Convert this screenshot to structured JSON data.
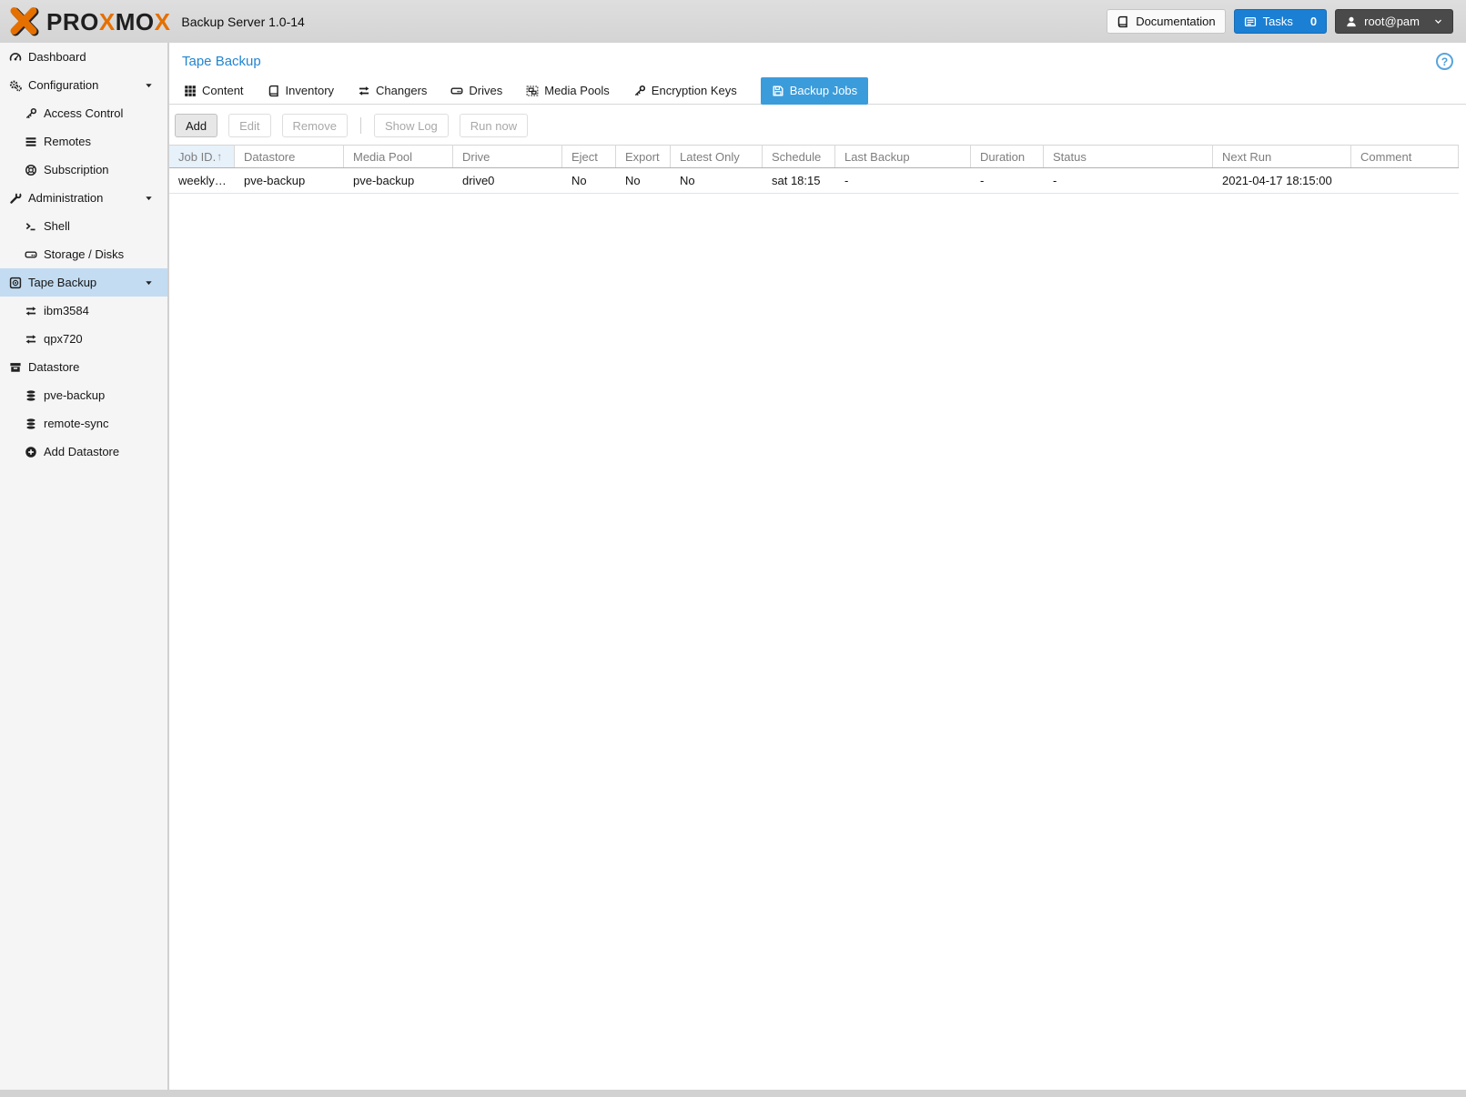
{
  "colors": {
    "accent": "#1b7fd4",
    "tab-active": "#3b9cdb",
    "selected-bg": "#c3dcf1",
    "title-blue": "#2385cf",
    "brand-orange": "#e57000",
    "brand-dark": "#1f1f1f"
  },
  "topbar": {
    "brand_letters": [
      {
        "text": "PRO",
        "color": "#1f1f1f"
      },
      {
        "text": "X",
        "color": "#e57000"
      },
      {
        "text": "MO",
        "color": "#1f1f1f"
      },
      {
        "text": "X",
        "color": "#e57000"
      }
    ],
    "product_title": "Backup Server 1.0-14",
    "documentation_label": "Documentation",
    "tasks_label": "Tasks",
    "tasks_count": "0",
    "user_label": "root@pam"
  },
  "sidebar": {
    "items": [
      {
        "label": "Dashboard",
        "icon": "dashboard-icon",
        "level": 0
      },
      {
        "label": "Configuration",
        "icon": "gears-icon",
        "level": 0,
        "expanded": true
      },
      {
        "label": "Access Control",
        "icon": "key-icon",
        "level": 1
      },
      {
        "label": "Remotes",
        "icon": "list-icon",
        "level": 1
      },
      {
        "label": "Subscription",
        "icon": "life-ring-icon",
        "level": 1
      },
      {
        "label": "Administration",
        "icon": "wrench-icon",
        "level": 0,
        "expanded": true
      },
      {
        "label": "Shell",
        "icon": "terminal-icon",
        "level": 1
      },
      {
        "label": "Storage / Disks",
        "icon": "hdd-icon",
        "level": 1
      },
      {
        "label": "Tape Backup",
        "icon": "tape-icon",
        "level": 0,
        "expanded": true,
        "selected": true
      },
      {
        "label": "ibm3584",
        "icon": "exchange-icon",
        "level": 1
      },
      {
        "label": "qpx720",
        "icon": "exchange-icon",
        "level": 1
      },
      {
        "label": "Datastore",
        "icon": "archive-icon",
        "level": 0
      },
      {
        "label": "pve-backup",
        "icon": "database-icon",
        "level": 1
      },
      {
        "label": "remote-sync",
        "icon": "database-icon",
        "level": 1
      },
      {
        "label": "Add Datastore",
        "icon": "plus-circle-icon",
        "level": 1
      }
    ]
  },
  "main": {
    "title": "Tape Backup",
    "help_label": "?",
    "tabs": [
      {
        "label": "Content",
        "icon": "grid-icon"
      },
      {
        "label": "Inventory",
        "icon": "book-icon"
      },
      {
        "label": "Changers",
        "icon": "exchange-icon"
      },
      {
        "label": "Drives",
        "icon": "hdd-icon"
      },
      {
        "label": "Media Pools",
        "icon": "object-group-icon"
      },
      {
        "label": "Encryption Keys",
        "icon": "key-icon"
      },
      {
        "label": "Backup Jobs",
        "icon": "save-icon",
        "active": true
      }
    ],
    "toolbar": [
      {
        "label": "Add",
        "enabled": true
      },
      {
        "label": "Edit",
        "enabled": false
      },
      {
        "label": "Remove",
        "enabled": false
      },
      {
        "separator": true
      },
      {
        "label": "Show Log",
        "enabled": false
      },
      {
        "label": "Run now",
        "enabled": false
      }
    ],
    "table": {
      "columns": [
        {
          "label": "Job ID.",
          "sorted": "asc"
        },
        {
          "label": "Datastore"
        },
        {
          "label": "Media Pool"
        },
        {
          "label": "Drive"
        },
        {
          "label": "Eject"
        },
        {
          "label": "Export"
        },
        {
          "label": "Latest Only"
        },
        {
          "label": "Schedule"
        },
        {
          "label": "Last Backup"
        },
        {
          "label": "Duration"
        },
        {
          "label": "Status"
        },
        {
          "label": "Next Run"
        },
        {
          "label": "Comment"
        }
      ],
      "rows": [
        [
          "weekly…",
          "pve-backup",
          "pve-backup",
          "drive0",
          "No",
          "No",
          "No",
          "sat 18:15",
          "-",
          "-",
          "-",
          "2021-04-17 18:15:00",
          ""
        ]
      ],
      "sort_arrow": "↑"
    }
  }
}
